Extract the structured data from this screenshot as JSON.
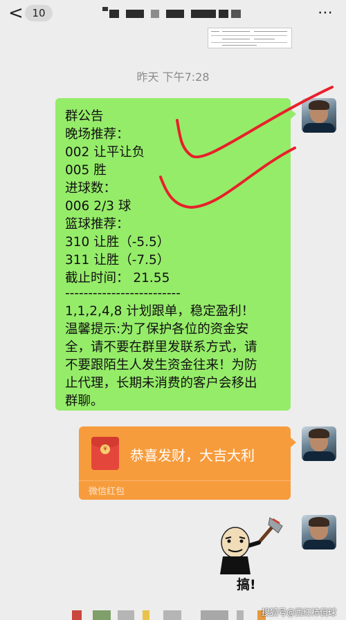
{
  "topbar": {
    "back_glyph": "<",
    "unread_count": "10",
    "more_glyph": "⋯",
    "back_icon": "chevron-left-icon",
    "more_icon": "more-dots-icon"
  },
  "timestamp": "昨天 下午7:28",
  "announcement": {
    "lines": [
      "群公告",
      "晚场推荐：",
      "002 让平让负",
      "005 胜",
      "进球数：",
      "006 2/3 球",
      "篮球推荐：",
      "310 让胜（-5.5）",
      "311 让胜（-7.5）",
      "截止时间： 21.55",
      "-------------------------",
      "1,1,2,4,8 计划跟单，稳定盈利！",
      "温馨提示:为了保护各位的资金安",
      "全，请不要在群里发联系方式，请",
      "不要跟陌生人发生资金往来！为防",
      "止代理，长期未消费的客户会移出",
      "群聊。"
    ],
    "bubble_color": "#95ec69",
    "check_color": "#e8202a"
  },
  "red_packet": {
    "greeting": "恭喜发财，大吉大利",
    "label": "微信红包",
    "color": "#f79c3c",
    "coin_glyph": "¥"
  },
  "sticker": {
    "caption": "搞!"
  },
  "watermark": "搜狐号@西红柿侃球"
}
